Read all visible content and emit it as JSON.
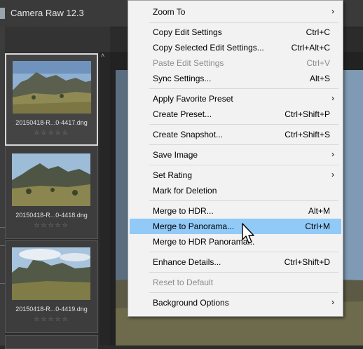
{
  "window": {
    "title": "Camera Raw 12.3",
    "controls": [
      "─",
      "☐",
      "✕"
    ]
  },
  "filmstrip": {
    "items": [
      {
        "filename": "20150418-R...0-4417.dng",
        "stars": "☆☆☆☆☆",
        "selected": true
      },
      {
        "filename": "20150418-R...0-4418.dng",
        "stars": "☆☆☆☆☆",
        "selected": false
      },
      {
        "filename": "20150418-R...0-4419.dng",
        "stars": "☆☆☆☆☆",
        "selected": false
      }
    ]
  },
  "context_menu": {
    "items": [
      {
        "label": "Zoom To",
        "shortcut": "",
        "submenu": true
      },
      {
        "label": "Copy Edit Settings",
        "shortcut": "Ctrl+C"
      },
      {
        "label": "Copy Selected Edit Settings...",
        "shortcut": "Ctrl+Alt+C"
      },
      {
        "label": "Paste Edit Settings",
        "shortcut": "Ctrl+V",
        "disabled": true
      },
      {
        "label": "Sync Settings...",
        "shortcut": "Alt+S"
      },
      {
        "label": "Apply Favorite Preset",
        "shortcut": "",
        "submenu": true
      },
      {
        "label": "Create Preset...",
        "shortcut": "Ctrl+Shift+P"
      },
      {
        "label": "Create Snapshot...",
        "shortcut": "Ctrl+Shift+S"
      },
      {
        "label": "Save Image",
        "shortcut": "",
        "submenu": true
      },
      {
        "label": "Set Rating",
        "shortcut": "",
        "submenu": true
      },
      {
        "label": "Mark for Deletion",
        "shortcut": ""
      },
      {
        "label": "Merge to HDR...",
        "shortcut": "Alt+M"
      },
      {
        "label": "Merge to Panorama...",
        "shortcut": "Ctrl+M",
        "highlighted": true
      },
      {
        "label": "Merge to HDR Panorama...",
        "shortcut": ""
      },
      {
        "label": "Enhance Details...",
        "shortcut": "Ctrl+Shift+D"
      },
      {
        "label": "Reset to Default",
        "shortcut": "",
        "disabled": true
      },
      {
        "label": "Background Options",
        "shortcut": "",
        "submenu": true
      }
    ],
    "submenu_glyph": "›"
  },
  "colors": {
    "menu_highlight": "#91c9f7",
    "menu_bg": "#f2f2f2",
    "app_bg": "#2b2b2b"
  }
}
